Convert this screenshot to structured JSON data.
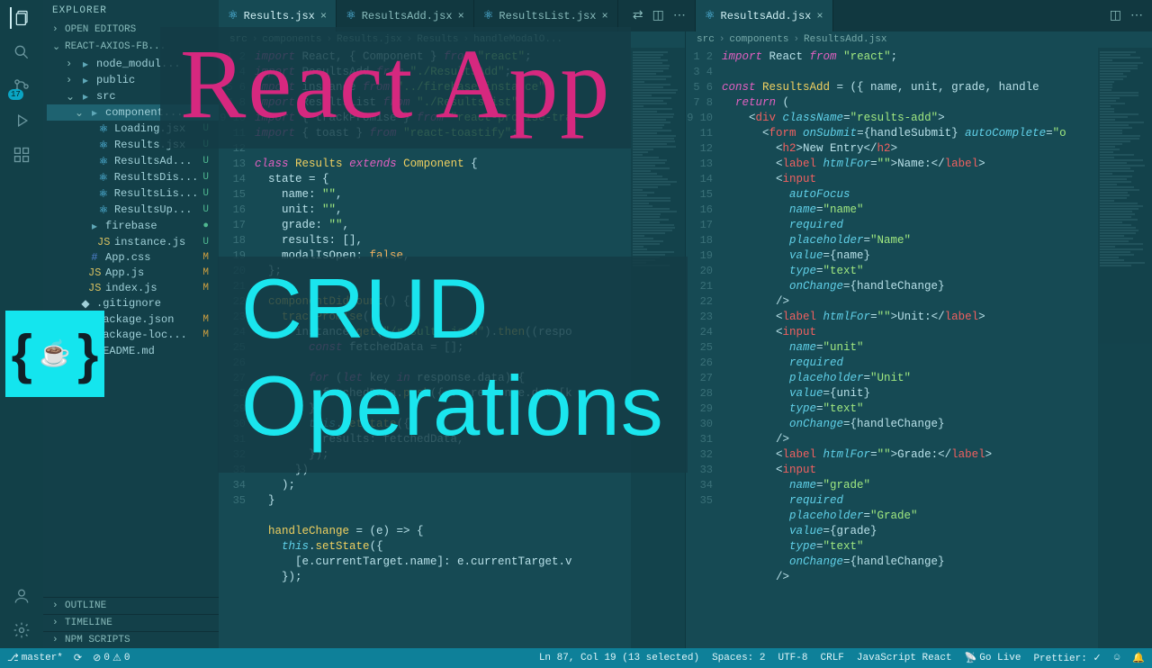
{
  "overlay": {
    "title": "React App",
    "subtitle_l1": "CRUD",
    "subtitle_l2": "Operations"
  },
  "explorer": {
    "header": "EXPLORER",
    "open_editors": "OPEN EDITORS",
    "project": "REACT-AXIOS-FB...",
    "outline": "OUTLINE",
    "timeline": "TIMELINE",
    "npm": "NPM SCRIPTS"
  },
  "tree": [
    {
      "ind": 1,
      "chev": "›",
      "icon": "folder",
      "name": "node_modul...",
      "st": "",
      "cls": ""
    },
    {
      "ind": 1,
      "chev": "›",
      "icon": "folder",
      "name": "public",
      "st": "",
      "cls": ""
    },
    {
      "ind": 1,
      "chev": "⌄",
      "icon": "folder",
      "name": "src",
      "st": "",
      "cls": ""
    },
    {
      "ind": 2,
      "chev": "⌄",
      "icon": "folder",
      "name": "component...",
      "st": "",
      "cls": "",
      "active": true
    },
    {
      "ind": 3,
      "chev": "",
      "icon": "react",
      "name": "Loading.jsx",
      "st": "U",
      "cls": ""
    },
    {
      "ind": 3,
      "chev": "",
      "icon": "react",
      "name": "Results.jsx",
      "st": "U",
      "cls": ""
    },
    {
      "ind": 3,
      "chev": "",
      "icon": "react",
      "name": "ResultsAd...",
      "st": "U",
      "cls": ""
    },
    {
      "ind": 3,
      "chev": "",
      "icon": "react",
      "name": "ResultsDis...",
      "st": "U",
      "cls": ""
    },
    {
      "ind": 3,
      "chev": "",
      "icon": "react",
      "name": "ResultsLis...",
      "st": "U",
      "cls": ""
    },
    {
      "ind": 3,
      "chev": "",
      "icon": "react",
      "name": "ResultsUp...",
      "st": "U",
      "cls": ""
    },
    {
      "ind": 2,
      "chev": "",
      "icon": "folder",
      "name": "firebase",
      "st": "●",
      "cls": ""
    },
    {
      "ind": 3,
      "chev": "",
      "icon": "js",
      "name": "instance.js",
      "st": "U",
      "cls": ""
    },
    {
      "ind": 2,
      "chev": "",
      "icon": "css",
      "name": "App.css",
      "st": "M",
      "cls": "m"
    },
    {
      "ind": 2,
      "chev": "",
      "icon": "js",
      "name": "App.js",
      "st": "M",
      "cls": "m"
    },
    {
      "ind": 2,
      "chev": "",
      "icon": "js",
      "name": "index.js",
      "st": "M",
      "cls": "m"
    },
    {
      "ind": 1,
      "chev": "",
      "icon": "git",
      "name": ".gitignore",
      "st": "",
      "cls": ""
    },
    {
      "ind": 1,
      "chev": "",
      "icon": "json",
      "name": "package.json",
      "st": "M",
      "cls": "m"
    },
    {
      "ind": 1,
      "chev": "",
      "icon": "json",
      "name": "package-loc...",
      "st": "M",
      "cls": "m"
    },
    {
      "ind": 1,
      "chev": "",
      "icon": "md",
      "name": "README.md",
      "st": "",
      "cls": ""
    }
  ],
  "tabs_left": [
    {
      "name": "Results.jsx",
      "active": true
    },
    {
      "name": "ResultsAdd.jsx",
      "active": false
    },
    {
      "name": "ResultsList.jsx",
      "active": false
    }
  ],
  "tabs_right": [
    {
      "name": "ResultsAdd.jsx",
      "active": true
    }
  ],
  "breadcrumb_left": [
    "src",
    "components",
    "Results.jsx",
    "Results",
    "handleModalO..."
  ],
  "breadcrumb_right": [
    "src",
    "components",
    "ResultsAdd.jsx"
  ],
  "status": {
    "branch": "master*",
    "sync": "⟳",
    "errors": "0",
    "warnings": "0",
    "ln_col": "Ln 87, Col 19 (13 selected)",
    "spaces": "Spaces: 2",
    "encoding": "UTF-8",
    "eol": "CRLF",
    "lang": "JavaScript React",
    "golive": "Go Live",
    "prettier": "Prettier: ✓"
  },
  "scm_badge": "17",
  "code_left_start": 1,
  "code_left": [
    "<span class='kw'>import</span> React, { Component } <span class='kw'>from</span> <span class='str'>\"react\"</span>;",
    "<span class='kw'>import</span> ResultsAdd <span class='kw'>from</span> <span class='str'>\"./ResultsAdd\"</span>;",
    "<span class='kw'>import</span> instance <span class='kw'>from</span> <span class='str'>\"../firebase/instance\"</span>;",
    "<span class='kw'>import</span> ResultsList <span class='kw'>from</span> <span class='str'>\"./ResultsList\"</span>;",
    "<span class='kw'>import</span> { trackPromise } <span class='kw'>from</span> <span class='str'>\"react-promise-tra</span>",
    "<span class='kw'>import</span> { toast } <span class='kw'>from</span> <span class='str'>\"react-toastify\"</span>;",
    "",
    "<span class='kw'>class</span> <span class='cls'>Results</span> <span class='kw'>extends</span> <span class='cls'>Component</span> {",
    "  state = {",
    "    name: <span class='str'>\"\"</span>,",
    "    unit: <span class='str'>\"\"</span>,",
    "    grade: <span class='str'>\"\"</span>,",
    "    results: [],",
    "    modalIsOpen: <span class='num'>false</span>,",
    "  };",
    "",
    "  <span class='fn'>componentDidMount</span>() {",
    "    <span class='fn'>trackPromise</span>(",
    "      instance.<span class='fn'>get</span>(<span class='str'>\"/results.json\"</span>).<span class='fn'>then</span>((respo",
    "        <span class='kw'>const</span> fetchedData = [];",
    "",
    "        <span class='kw'>for</span> (<span class='kw'>let</span> key <span class='kw'>in</span> response.data) {",
    "          fetchedData.<span class='fn'>push</span>({ ...response.data[k",
    "        }",
    "        <span class='kw2'>this</span>.<span class='fn'>setState</span>({",
    "          results: fetchedData,",
    "        });",
    "      })",
    "    );",
    "  }",
    "",
    "  <span class='fn'>handleChange</span> = (e) => {",
    "    <span class='kw2'>this</span>.<span class='fn'>setState</span>({",
    "      [e.currentTarget.name]: e.currentTarget.v",
    "    });"
  ],
  "code_right_start": 1,
  "code_right": [
    "<span class='kw'>import</span> React <span class='kw'>from</span> <span class='str'>\"react\"</span>;",
    "",
    "<span class='kw'>const</span> <span class='cls'>ResultsAdd</span> = ({ name, unit, grade, handle",
    "  <span class='kw'>return</span> (",
    "    &lt;<span class='tag'>div</span> <span class='attr'>className</span>=<span class='str'>\"results-add\"</span>&gt;",
    "      &lt;<span class='tag'>form</span> <span class='attr'>onSubmit</span>={handleSubmit} <span class='attr'>autoComplete</span>=<span class='str'>\"o</span>",
    "        &lt;<span class='tag'>h2</span>&gt;New Entry&lt;/<span class='tag'>h2</span>&gt;",
    "        &lt;<span class='tag'>label</span> <span class='attr'>htmlFor</span>=<span class='str'>\"\"</span>&gt;Name:&lt;/<span class='tag'>label</span>&gt;",
    "        &lt;<span class='tag'>input</span>",
    "          <span class='attr'>autoFocus</span>",
    "          <span class='attr'>name</span>=<span class='str'>\"name\"</span>",
    "          <span class='attr'>required</span>",
    "          <span class='attr'>placeholder</span>=<span class='str'>\"Name\"</span>",
    "          <span class='attr'>value</span>={name}",
    "          <span class='attr'>type</span>=<span class='str'>\"text\"</span>",
    "          <span class='attr'>onChange</span>={handleChange}",
    "        /&gt;",
    "        &lt;<span class='tag'>label</span> <span class='attr'>htmlFor</span>=<span class='str'>\"\"</span>&gt;Unit:&lt;/<span class='tag'>label</span>&gt;",
    "        &lt;<span class='tag'>input</span>",
    "          <span class='attr'>name</span>=<span class='str'>\"unit\"</span>",
    "          <span class='attr'>required</span>",
    "          <span class='attr'>placeholder</span>=<span class='str'>\"Unit\"</span>",
    "          <span class='attr'>value</span>={unit}",
    "          <span class='attr'>type</span>=<span class='str'>\"text\"</span>",
    "          <span class='attr'>onChange</span>={handleChange}",
    "        /&gt;",
    "        &lt;<span class='tag'>label</span> <span class='attr'>htmlFor</span>=<span class='str'>\"\"</span>&gt;Grade:&lt;/<span class='tag'>label</span>&gt;",
    "        &lt;<span class='tag'>input</span>",
    "          <span class='attr'>name</span>=<span class='str'>\"grade\"</span>",
    "          <span class='attr'>required</span>",
    "          <span class='attr'>placeholder</span>=<span class='str'>\"Grade\"</span>",
    "          <span class='attr'>value</span>={grade}",
    "          <span class='attr'>type</span>=<span class='str'>\"text\"</span>",
    "          <span class='attr'>onChange</span>={handleChange}",
    "        /&gt;"
  ]
}
